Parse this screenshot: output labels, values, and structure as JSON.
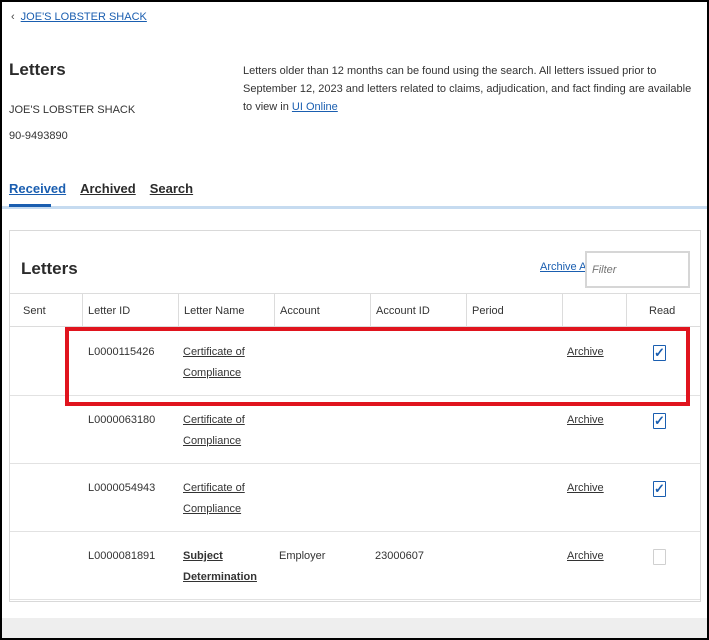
{
  "back_link": {
    "label": "JOE'S LOBSTER SHACK"
  },
  "header": {
    "title": "Letters",
    "employer_name": "JOE'S LOBSTER SHACK",
    "employer_id": "90-9493890",
    "info_text": "Letters older than 12 months can be found using the search. All letters issued prior to September 12, 2023 and letters related to claims, adjudication, and fact finding are available to view in ",
    "info_link": "UI Online"
  },
  "tabs": [
    {
      "label": "Received",
      "active": true
    },
    {
      "label": "Archived",
      "active": false
    },
    {
      "label": "Search",
      "active": false
    }
  ],
  "panel": {
    "title": "Letters",
    "archive_all_label": "Archive All",
    "filter_placeholder": "Filter",
    "columns": [
      "Sent",
      "Letter ID",
      "Letter Name",
      "Account",
      "Account ID",
      "Period",
      "",
      "Read"
    ],
    "rows": [
      {
        "sent": "",
        "letter_id": "L0000115426",
        "letter_name": "Certificate of Compliance",
        "account": "",
        "account_id": "",
        "period": "",
        "action": "Archive",
        "read": true
      },
      {
        "sent": "",
        "letter_id": "L0000063180",
        "letter_name": "Certificate of Compliance",
        "account": "",
        "account_id": "",
        "period": "",
        "action": "Archive",
        "read": true
      },
      {
        "sent": "",
        "letter_id": "L0000054943",
        "letter_name": "Certificate of Compliance",
        "account": "",
        "account_id": "",
        "period": "",
        "action": "Archive",
        "read": true
      },
      {
        "sent": "",
        "letter_id": "L0000081891",
        "letter_name": "Subject Determination",
        "account": "Employer",
        "account_id": "23000607",
        "period": "",
        "action": "Archive",
        "read": false
      }
    ]
  },
  "colors": {
    "link": "#1a5eb0",
    "highlight": "#e0141e",
    "tab_underline": "#c6dbf0"
  },
  "icons": {
    "back": "chevron-left-icon",
    "checkbox": "checkmark-icon"
  }
}
